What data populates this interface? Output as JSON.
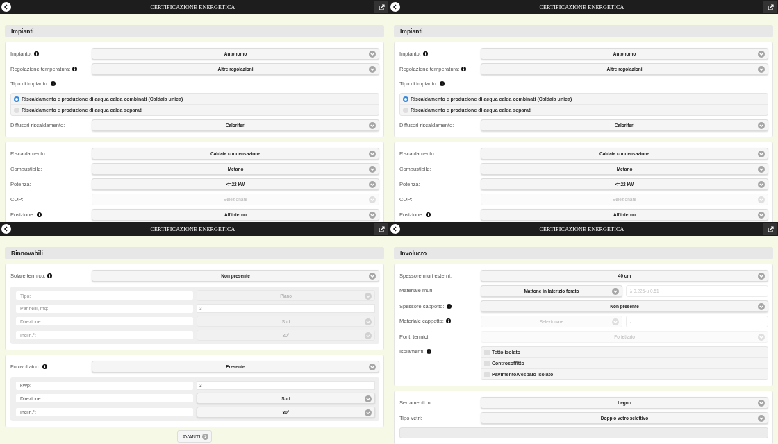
{
  "panels": [
    {
      "title": "CERTIFICAZIONE ENERGETICA",
      "heading": "Impianti",
      "cards": [
        {
          "rows": [
            {
              "kind": "select",
              "label": "Impianto:",
              "info": true,
              "value": "Autonomo",
              "disabled": false
            },
            {
              "kind": "select",
              "label": "Regolazione temperatura:",
              "info": true,
              "value": "Altre regolazioni",
              "disabled": false
            },
            {
              "kind": "label",
              "label": "Tipo di impianto:",
              "info": true
            },
            {
              "kind": "radios",
              "options": [
                {
                  "label": "Riscaldamento e produzione di acqua calda combinati (Caldaia unica)",
                  "selected": true
                },
                {
                  "label": "Riscaldamento e produzione di acqua calda separati",
                  "selected": false
                }
              ]
            },
            {
              "kind": "select",
              "label": "Diffusori riscaldamento:",
              "info": false,
              "value": "Caloriferi",
              "disabled": false
            }
          ]
        },
        {
          "rows": [
            {
              "kind": "select",
              "label": "Riscaldamento:",
              "info": false,
              "value": "Caldaia condensazione",
              "disabled": false
            },
            {
              "kind": "select",
              "label": "Combustibile:",
              "info": false,
              "value": "Metano",
              "disabled": false
            },
            {
              "kind": "select",
              "label": "Potenza:",
              "info": false,
              "value": "<=22 kW",
              "disabled": false
            },
            {
              "kind": "select",
              "label": "COP:",
              "info": false,
              "value": "Selezionare",
              "disabled": true
            },
            {
              "kind": "select",
              "label": "Posizione:",
              "info": true,
              "value": "All'interno",
              "disabled": false
            }
          ]
        }
      ]
    },
    {
      "title": "CERTIFICAZIONE ENERGETICA",
      "heading": "Impianti",
      "cards": [
        {
          "rows": [
            {
              "kind": "select",
              "label": "Impianto:",
              "info": true,
              "value": "Autonomo",
              "disabled": false
            },
            {
              "kind": "select",
              "label": "Regolazione temperatura:",
              "info": true,
              "value": "Altre regolazioni",
              "disabled": false
            },
            {
              "kind": "label",
              "label": "Tipo di impianto:",
              "info": true
            },
            {
              "kind": "radios",
              "options": [
                {
                  "label": "Riscaldamento e produzione di acqua calda combinati (Caldaia unica)",
                  "selected": true
                },
                {
                  "label": "Riscaldamento e produzione di acqua calda separati",
                  "selected": false
                }
              ]
            },
            {
              "kind": "select",
              "label": "Diffusori riscaldamento:",
              "info": false,
              "value": "Caloriferi",
              "disabled": false
            }
          ]
        },
        {
          "rows": [
            {
              "kind": "select",
              "label": "Riscaldamento:",
              "info": false,
              "value": "Caldaia condensazione",
              "disabled": false
            },
            {
              "kind": "select",
              "label": "Combustibile:",
              "info": false,
              "value": "Metano",
              "disabled": false
            },
            {
              "kind": "select",
              "label": "Potenza:",
              "info": false,
              "value": "<=22 kW",
              "disabled": false
            },
            {
              "kind": "select",
              "label": "COP:",
              "info": false,
              "value": "Selezionare",
              "disabled": true
            },
            {
              "kind": "select",
              "label": "Posizione:",
              "info": true,
              "value": "All'interno",
              "disabled": false
            }
          ]
        }
      ]
    },
    {
      "title": "CERTIFICAZIONE ENERGETICA",
      "heading": "Rinnovabili",
      "cards": [
        {
          "rows": [
            {
              "kind": "select",
              "label": "Solare termico:",
              "info": true,
              "value": "Non presente",
              "disabled": false
            },
            {
              "kind": "subbox",
              "disabled": true,
              "rows": [
                {
                  "kind": "select",
                  "label": "Tipo:",
                  "value": "Piano"
                },
                {
                  "kind": "input",
                  "label": "Pannelli, mq:",
                  "value": "3"
                },
                {
                  "kind": "select",
                  "label": "Direzione:",
                  "value": "Sud"
                },
                {
                  "kind": "select",
                  "label": "Inclin.°:",
                  "value": "30°"
                }
              ]
            }
          ]
        },
        {
          "rows": [
            {
              "kind": "select",
              "label": "Fotovoltaico:",
              "info": true,
              "value": "Presente",
              "disabled": false
            },
            {
              "kind": "subbox",
              "disabled": false,
              "rows": [
                {
                  "kind": "input",
                  "label": "kWp:",
                  "value": "3"
                },
                {
                  "kind": "select",
                  "label": "Direzione:",
                  "value": "Sud"
                },
                {
                  "kind": "select",
                  "label": "Inclin.°:",
                  "value": "30°"
                }
              ]
            }
          ]
        }
      ],
      "button": "AVANTI"
    },
    {
      "title": "CERTIFICAZIONE ENERGETICA",
      "heading": "Involucro",
      "cards": [
        {
          "rows": [
            {
              "kind": "select",
              "label": "Spessore muri esterni:",
              "info": false,
              "value": "40 cm",
              "disabled": false
            },
            {
              "kind": "select_input",
              "label": "Materiale muri:",
              "info": false,
              "value": "Mattone in laterizio forato",
              "placeholder": "λ 0.225-u 0.51",
              "disabled": false
            },
            {
              "kind": "select",
              "label": "Spessore cappotto:",
              "info": true,
              "value": "Non presente",
              "disabled": false
            },
            {
              "kind": "select_input",
              "label": "Materiale cappotto:",
              "info": true,
              "value": "Selezionare",
              "placeholder": "-",
              "disabled": true
            },
            {
              "kind": "select",
              "label": "Ponti termici:",
              "info": false,
              "value": "Forfettario",
              "disabled": true
            },
            {
              "kind": "checks",
              "label": "Isolamenti:",
              "info": true,
              "options": [
                {
                  "label": "Tetto isolato",
                  "checked": false
                },
                {
                  "label": "Controsoffitto",
                  "checked": false
                },
                {
                  "label": "Pavimento/Vespaio isolato",
                  "checked": false
                }
              ]
            }
          ]
        },
        {
          "rows": [
            {
              "kind": "select",
              "label": "Serramenti in:",
              "info": false,
              "value": "Legno",
              "disabled": false
            },
            {
              "kind": "select",
              "label": "Tipo vetri:",
              "info": false,
              "value": "Doppio vetro selettivo",
              "disabled": false
            },
            {
              "kind": "box"
            }
          ]
        }
      ]
    }
  ]
}
